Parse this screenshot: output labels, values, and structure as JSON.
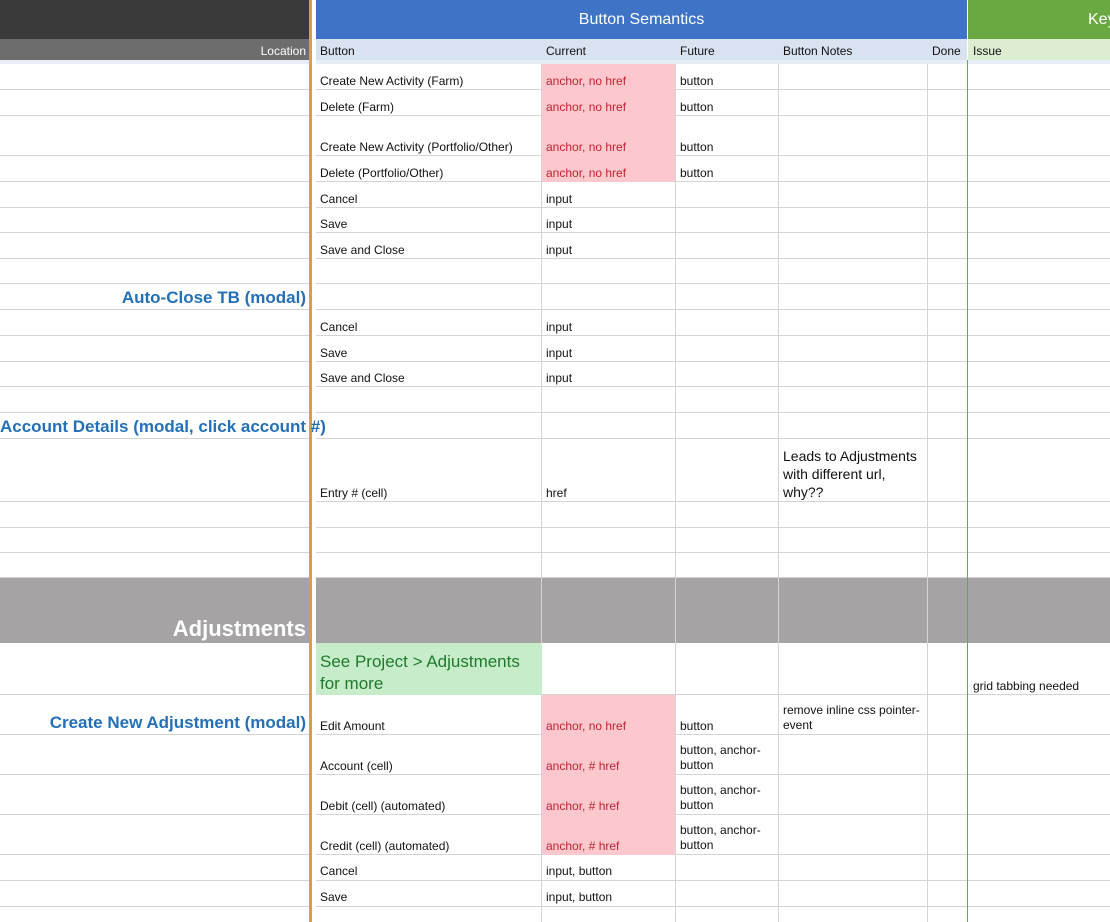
{
  "header": {
    "button_semantics": "Button Semantics",
    "key_partial": "Key"
  },
  "columns": {
    "location": "Location",
    "button": "Button",
    "current": "Current",
    "future": "Future",
    "button_notes": "Button Notes",
    "done": "Done",
    "issue": "Issue"
  },
  "sections": {
    "auto_close": "Auto-Close TB (modal)",
    "account_details": "Account Details (modal, click account #)",
    "adjustments": "Adjustments",
    "create_new_adjustment": "Create New Adjustment (modal)"
  },
  "rows": [
    {
      "button": "Create New Activity (Farm)",
      "current": "anchor, no href",
      "future": "button"
    },
    {
      "button": "Delete (Farm)",
      "current": "anchor, no href",
      "future": "button"
    },
    {
      "button": "Create New Activity (Portfolio/Other)",
      "current": "anchor, no href",
      "future": "button"
    },
    {
      "button": "Delete (Portfolio/Other)",
      "current": "anchor, no href",
      "future": "button"
    },
    {
      "button": "Cancel",
      "current": "input"
    },
    {
      "button": "Save",
      "current": "input"
    },
    {
      "button": "Save and Close",
      "current": "input"
    },
    {
      "button": "Cancel",
      "current": "input"
    },
    {
      "button": "Save",
      "current": "input"
    },
    {
      "button": "Save and Close",
      "current": "input"
    },
    {
      "button": "Entry # (cell)",
      "current": "href",
      "notes": "Leads to Adjustments with different url, why??"
    },
    {
      "note": "See Project >  Adjustments for more",
      "issue": "grid tabbing needed"
    },
    {
      "button": "Edit Amount",
      "current": "anchor, no href",
      "future": "button",
      "notes": "remove inline css pointer-event"
    },
    {
      "button": "Account (cell)",
      "current": "anchor, # href",
      "future": "button, anchor-button"
    },
    {
      "button": "Debit (cell) (automated)",
      "current": "anchor, # href",
      "future": "button, anchor-button"
    },
    {
      "button": "Credit (cell) (automated)",
      "current": "anchor, # href",
      "future": "button, anchor-button"
    },
    {
      "button": "Cancel",
      "current": "input, button"
    },
    {
      "button": "Save",
      "current": "input, button"
    }
  ]
}
